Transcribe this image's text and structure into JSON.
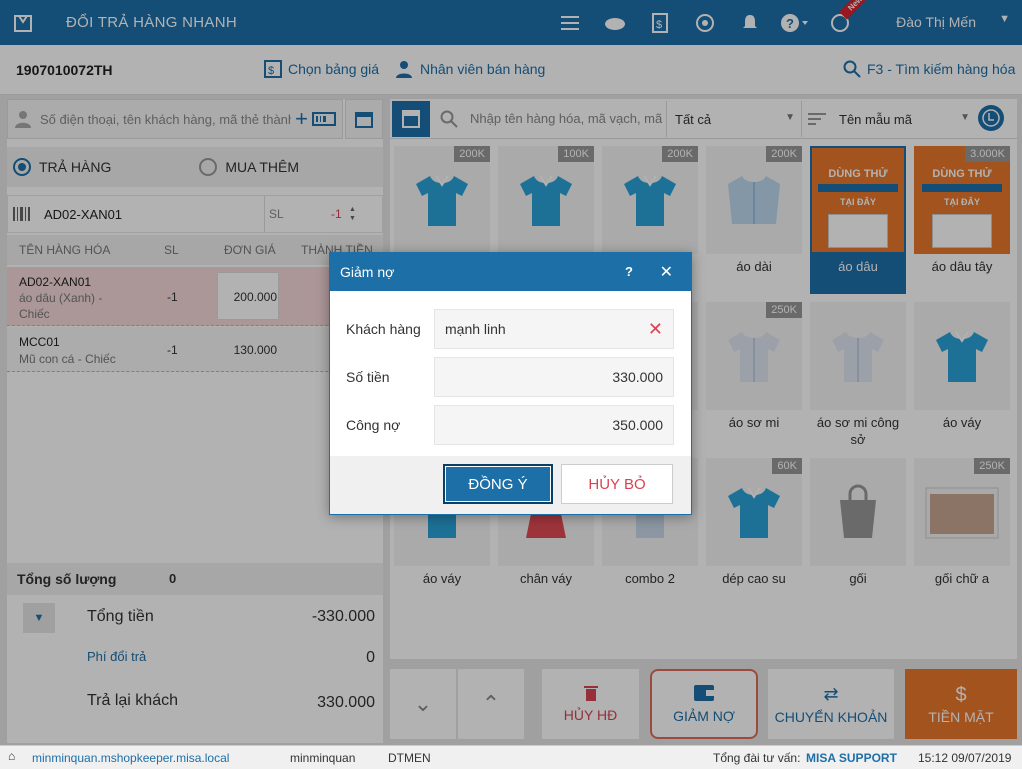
{
  "app": {
    "title": "ĐỔI TRẢ HÀNG NHANH",
    "user": "Đào Thị Mến",
    "new_badge": "New"
  },
  "subbar": {
    "invoice": "1907010072TH",
    "price_list": "Chọn bảng giá",
    "staff": "Nhân viên bán hàng",
    "search_hint": "F3 - Tìm kiếm hàng hóa"
  },
  "left": {
    "customer_placeholder": "Số điện thoại, tên khách hàng, mã thẻ thành viên",
    "mode_return": "TRẢ HÀNG",
    "mode_buy": "MUA THÊM",
    "scan_code": "AD02-XAN01",
    "scan_sl_label": "SL",
    "scan_sl_value": "-1",
    "columns": [
      "TÊN HÀNG HÓA",
      "SL",
      "ĐƠN GIÁ",
      "THÀNH TIỀN"
    ],
    "rows": [
      {
        "code": "AD02-XAN01",
        "desc": "áo dâu (Xanh) - Chiếc",
        "qty": "-1",
        "price": "200.000"
      },
      {
        "code": "MCC01",
        "desc": "Mũ con cá - Chiếc",
        "qty": "-1",
        "price": "130.000"
      }
    ],
    "total_qty_label": "Tổng số lượng",
    "total_qty": "0",
    "total_label": "Tổng tiền",
    "total": "-330.000",
    "fee_label": "Phí đổi trả",
    "fee": "0",
    "refund_label": "Trả lại khách",
    "refund": "330.000"
  },
  "right": {
    "search_placeholder": "Nhập tên hàng hóa, mã vạch, mã",
    "filter_all": "Tất cả",
    "sort": "Tên mẫu mã",
    "products": [
      {
        "name": "",
        "tag": "200K"
      },
      {
        "name": "",
        "tag": "100K"
      },
      {
        "name": "",
        "tag": "200K"
      },
      {
        "name": "áo dài",
        "tag": "200K"
      },
      {
        "name": "áo dâu",
        "tag": ""
      },
      {
        "name": "áo dâu tây",
        "tag": "3.000K"
      },
      {
        "name": "",
        "tag": ""
      },
      {
        "name": "",
        "tag": ""
      },
      {
        "name": "",
        "tag": ""
      },
      {
        "name": "áo sơ mi",
        "tag": "250K"
      },
      {
        "name": "áo sơ mi công sở",
        "tag": ""
      },
      {
        "name": "áo váy",
        "tag": ""
      },
      {
        "name": "áo váy",
        "tag": ""
      },
      {
        "name": "chân váy",
        "tag": ""
      },
      {
        "name": "combo 2",
        "tag": ""
      },
      {
        "name": "dép cao su",
        "tag": "60K"
      },
      {
        "name": "gối",
        "tag": ""
      },
      {
        "name": "gối chữ a",
        "tag": "250K"
      }
    ],
    "ad_text": "DÙNG THỬ",
    "ad_sub": "TẠI ĐÂY"
  },
  "bottom": {
    "delete": "HỦY HĐ",
    "debt": "GIẢM NỢ",
    "transfer": "CHUYỂN KHOẢN",
    "cash": "TIỀN MẶT"
  },
  "status": {
    "domain": "minminquan.mshopkeeper.misa.local",
    "shop": "minminquan",
    "staff": "DTMEN",
    "support_label": "Tổng đài tư vấn:",
    "support": "MISA SUPPORT",
    "time": "15:12 09/07/2019"
  },
  "dialog": {
    "title": "Giảm nợ",
    "help": "?",
    "customer_label": "Khách hàng",
    "customer": "mạnh linh",
    "amount_label": "Số tiền",
    "amount": "330.000",
    "debt_label": "Công nợ",
    "debt": "350.000",
    "ok": "ĐỒNG Ý",
    "cancel": "HỦY BỎ"
  },
  "colors": {
    "primary": "#1d6fa8",
    "danger": "#d94452",
    "cash": "#e8782b"
  }
}
